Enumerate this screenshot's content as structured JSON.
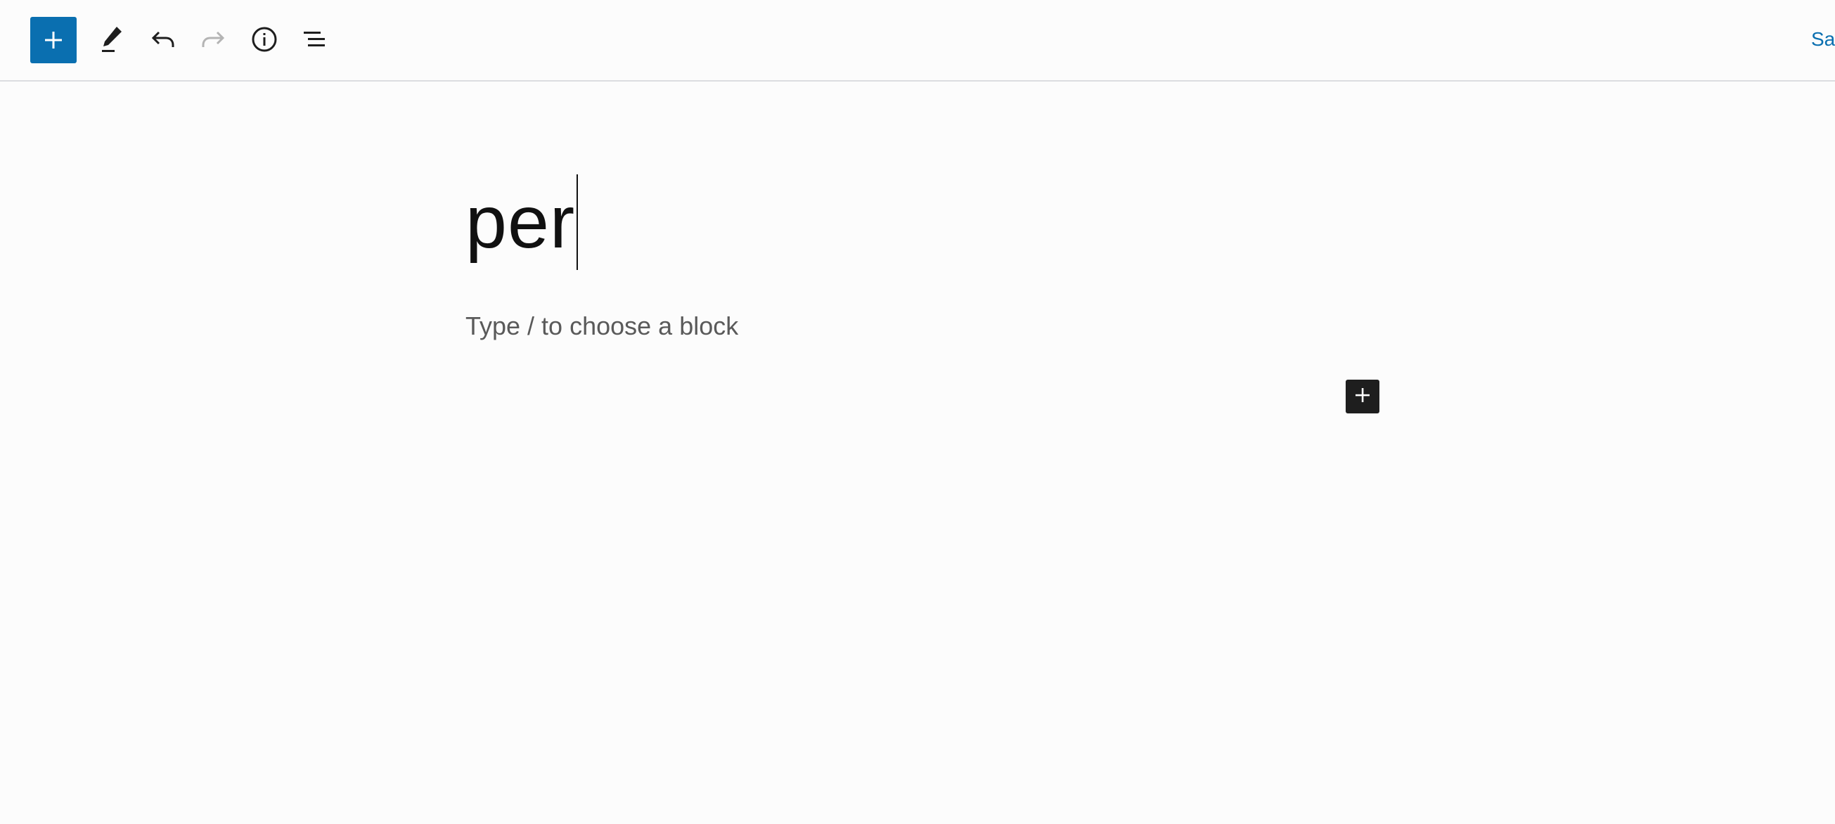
{
  "toolbar": {
    "save_label": "Sa",
    "icons": {
      "inserter": "plus-icon",
      "tools": "pencil-icon",
      "undo": "undo-icon",
      "redo": "redo-icon",
      "details": "info-icon",
      "outline": "list-view-icon"
    },
    "colors": {
      "accent": "#0a6fb0",
      "disabled": "#b4b4b4"
    }
  },
  "editor": {
    "title_text": "per",
    "block_placeholder": "Type / to choose a block",
    "block_inserter_icon": "plus-icon"
  }
}
